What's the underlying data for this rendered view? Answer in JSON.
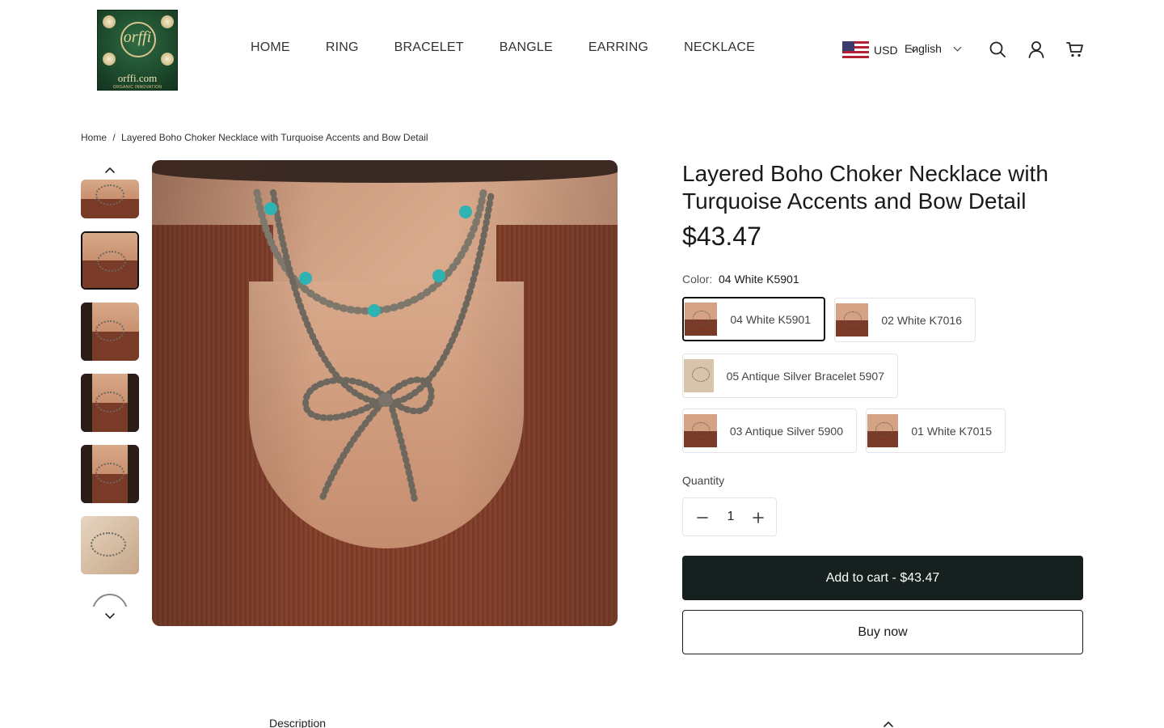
{
  "brand": {
    "logo_name": "orffi.com",
    "logo_mark": "orffi",
    "logo_tagline": "ORGANIC INNOVATION",
    "logo_color": "#1d4a2c"
  },
  "nav": {
    "items": [
      "HOME",
      "RING",
      "BRACELET",
      "BANGLE",
      "EARRING",
      "NECKLACE"
    ]
  },
  "header": {
    "currency": "USD",
    "currency_flag": "us-flag-icon",
    "language": "English",
    "icons": [
      "search-icon",
      "account-icon",
      "cart-icon"
    ]
  },
  "breadcrumb": {
    "home": "Home",
    "separator": "/",
    "current": "Layered Boho Choker Necklace with Turquoise Accents and Bow Detail"
  },
  "gallery": {
    "thumb_count": 7,
    "active_index": 1,
    "prev_icon": "chevron-up-icon",
    "next_icon": "chevron-down-icon"
  },
  "product": {
    "title": "Layered Boho Choker Necklace with Turquoise Accents and Bow Detail",
    "price": "$43.47",
    "color_label": "Color:",
    "color_value": "04 White K5901",
    "variants": [
      {
        "label": "04 White K5901",
        "selected": true
      },
      {
        "label": "02 White K7016",
        "selected": false
      },
      {
        "label": "05 Antique Silver Bracelet 5907",
        "selected": false
      },
      {
        "label": "03 Antique Silver 5900",
        "selected": false
      },
      {
        "label": "01 White K7015",
        "selected": false
      }
    ],
    "quantity_label": "Quantity",
    "quantity": "1",
    "add_to_cart": "Add to cart - $43.47",
    "buy_now": "Buy now",
    "accent_color": "#15201f"
  },
  "tabs": {
    "description": "Description"
  }
}
